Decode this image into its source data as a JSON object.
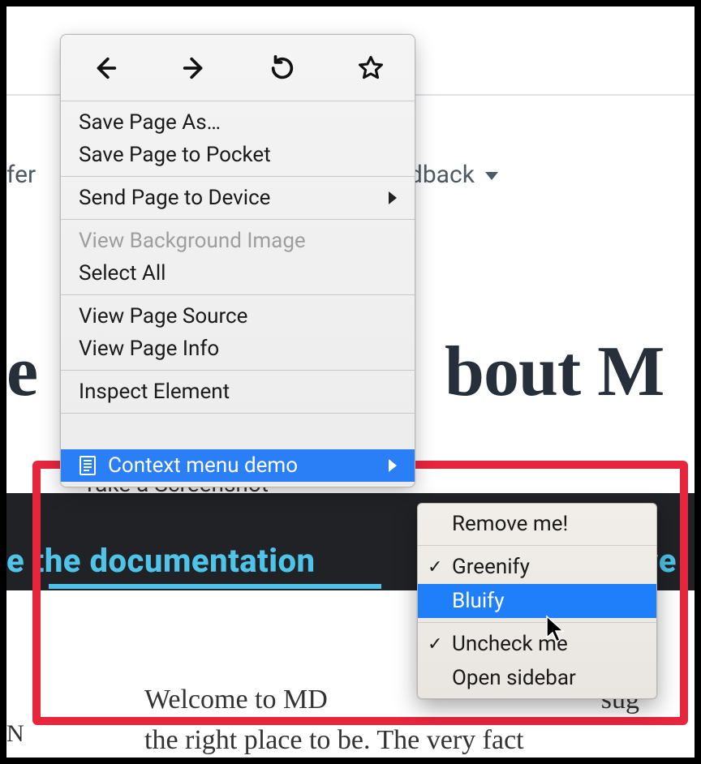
{
  "background": {
    "nav_left_fragment": "fer",
    "nav_right_fragment": "edback",
    "heading_left_fragment": "e",
    "heading_right_fragment": "bout M",
    "take_screenshot_fragment": "Take a Screenshot",
    "blue_link_left_fragment": "e the documentation",
    "blue_link_right_fragment": "nve",
    "para_line1": "Welcome to MD",
    "para_line1_suffix": "sug",
    "para_line2": "the right place to be. The very fact",
    "sidebar_fragment": "N"
  },
  "icons": {
    "back": "back-icon",
    "forward": "forward-icon",
    "reload": "reload-icon",
    "bookmark": "star-icon"
  },
  "context_menu": {
    "groups": [
      [
        {
          "label": "Save Page As…",
          "disabled": false
        },
        {
          "label": "Save Page to Pocket",
          "disabled": false
        }
      ],
      [
        {
          "label": "Send Page to Device",
          "disabled": false,
          "submenu": true
        }
      ],
      [
        {
          "label": "View Background Image",
          "disabled": true
        },
        {
          "label": "Select All",
          "disabled": false
        }
      ],
      [
        {
          "label": "View Page Source",
          "disabled": false
        },
        {
          "label": "View Page Info",
          "disabled": false
        }
      ],
      [
        {
          "label": "Inspect Element",
          "disabled": false
        }
      ]
    ],
    "demo_item": {
      "label": "Context menu demo",
      "submenu": true,
      "highlighted": true,
      "icon": "document-icon"
    }
  },
  "submenu": {
    "items": [
      {
        "label": "Remove me!",
        "checked": false,
        "highlighted": false
      },
      "sep",
      {
        "label": "Greenify",
        "checked": true,
        "highlighted": false
      },
      {
        "label": "Bluify",
        "checked": false,
        "highlighted": true
      },
      "sep",
      {
        "label": "Uncheck me",
        "checked": true,
        "highlighted": false
      },
      {
        "label": "Open sidebar",
        "checked": false,
        "highlighted": false
      }
    ]
  },
  "colors": {
    "highlight": "#1f7ef9",
    "red_box": "#e6263d",
    "link_blue": "#4fc3e8"
  }
}
